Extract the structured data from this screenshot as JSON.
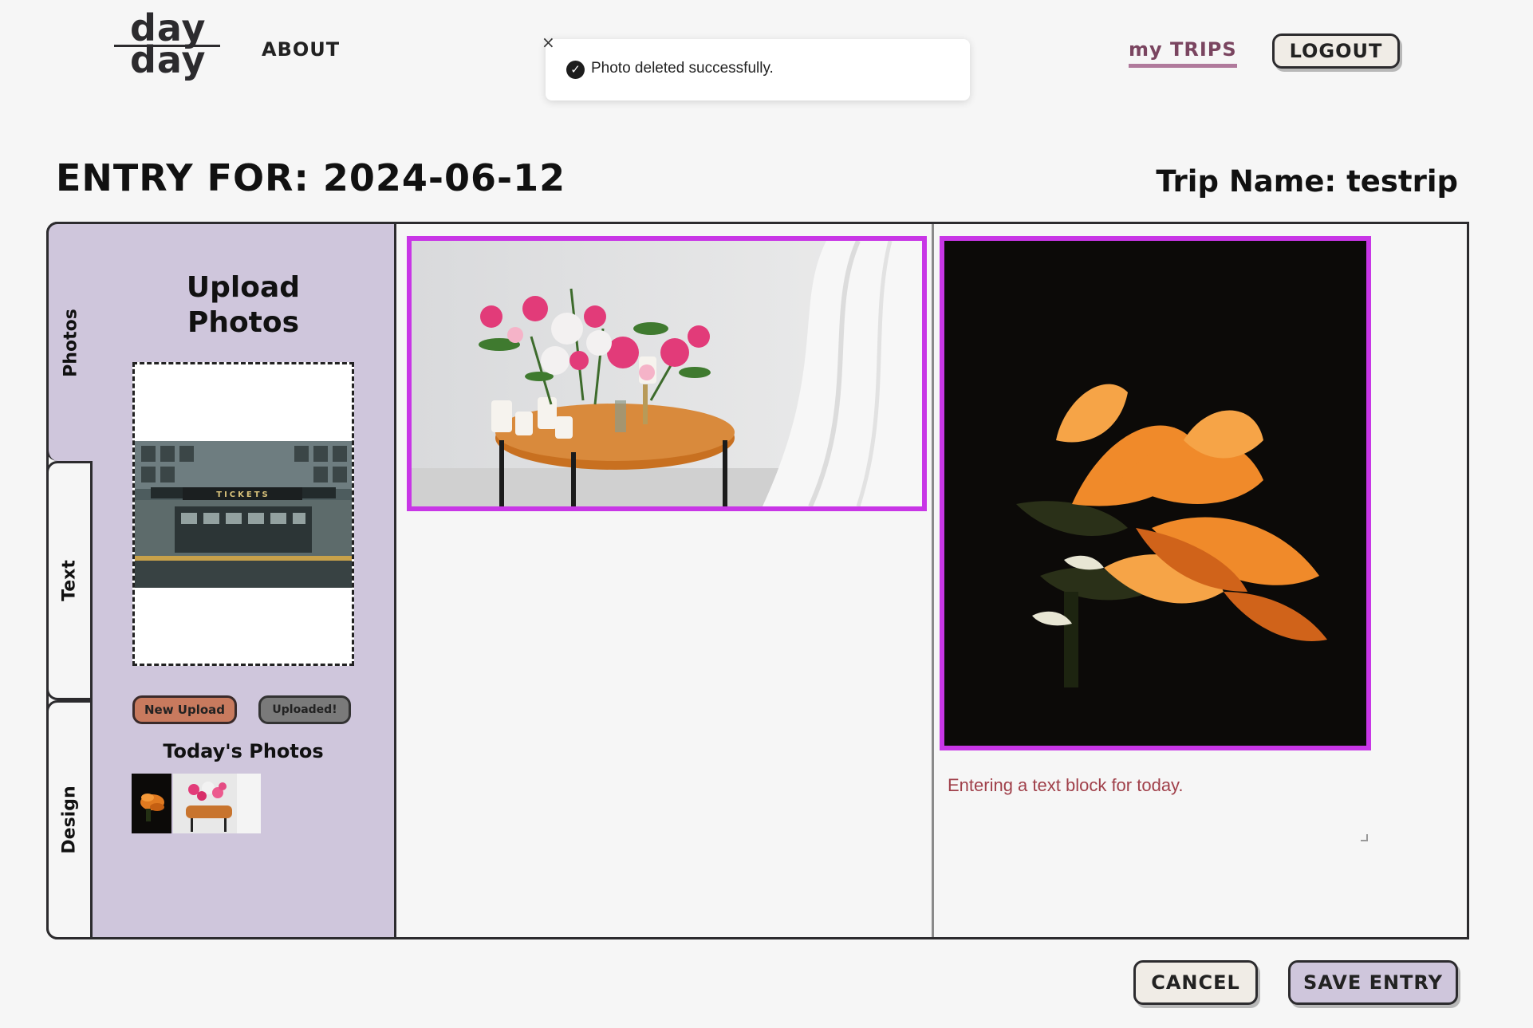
{
  "header": {
    "logo_top": "day",
    "logo_bottom": "day",
    "nav_about": "ABOUT",
    "nav_my_trips": "my TRIPS",
    "logout_label": "LOGOUT"
  },
  "toast": {
    "close_glyph": "×",
    "check_glyph": "✓",
    "message": "Photo deleted successfully."
  },
  "entry": {
    "title": "ENTRY FOR: 2024-06-12",
    "trip_name": "Trip Name: testrip"
  },
  "tabs": {
    "photos": "Photos",
    "text": "Text",
    "design": "Design"
  },
  "photos_panel": {
    "upload_title_line1": "Upload",
    "upload_title_line2": "Photos",
    "new_upload_label": "New Upload",
    "uploaded_label": "Uploaded!",
    "todays_photos_title": "Today's Photos"
  },
  "canvas": {
    "text_block": "Entering a text block for today."
  },
  "footer": {
    "cancel_label": "CANCEL",
    "save_label": "SAVE ENTRY"
  },
  "colors": {
    "accent_border": "#c836e6",
    "panel_bg": "#cfc6dc",
    "new_upload_bg": "#c87a5e",
    "text_block_color": "#a0404a"
  }
}
